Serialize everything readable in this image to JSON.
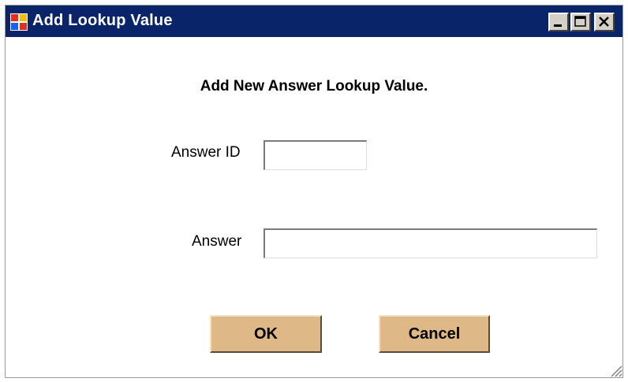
{
  "window": {
    "title": "Add Lookup Value",
    "icon": "app-window-icon",
    "controls": [
      "minimize-icon",
      "maximize-icon",
      "close-icon"
    ]
  },
  "form": {
    "heading": "Add New Answer Lookup Value.",
    "answer_id_label": "Answer ID",
    "answer_id_value": "",
    "answer_label": "Answer",
    "answer_value": ""
  },
  "buttons": {
    "ok_label": "OK",
    "cancel_label": "Cancel"
  },
  "colors": {
    "titlebar": "#0a246a",
    "button_face": "#deb887",
    "background": "#ffffff"
  }
}
